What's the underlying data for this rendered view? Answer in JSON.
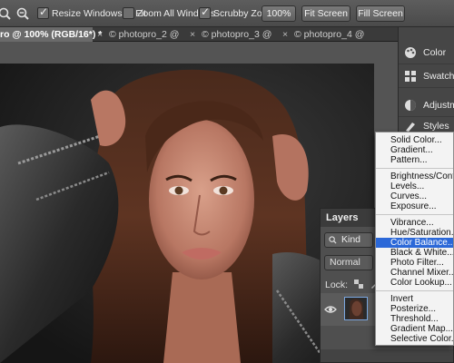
{
  "options_bar": {
    "resize_windows": {
      "label": "Resize Windows to Fit",
      "checked": true
    },
    "zoom_all": {
      "label": "Zoom All Windows",
      "checked": false
    },
    "scrubby_zoom": {
      "label": "Scrubby Zoom",
      "checked": true
    },
    "zoom_value": "100%",
    "fit_screen": "Fit Screen",
    "fill_screen": "Fill Screen"
  },
  "tabs": [
    {
      "label": "ro @ 100% (RGB/16*) *",
      "active": true
    },
    {
      "label": "© photopro_2 @",
      "active": false
    },
    {
      "label": "© photopro_3 @",
      "active": false
    },
    {
      "label": "© photopro_4 @",
      "active": false
    }
  ],
  "tab_close_glyph": "×",
  "dock": [
    {
      "label": "Color",
      "icon": "color-palette-icon"
    },
    {
      "label": "Swatches",
      "icon": "swatches-grid-icon"
    },
    {
      "label": "Adjustme",
      "icon": "adjustments-circle-icon"
    },
    {
      "label": "Styles",
      "icon": "styles-icon"
    }
  ],
  "layers_panel": {
    "title": "Layers",
    "filter_kind": "Kind",
    "blend_mode": "Normal",
    "lock_label": "Lock:"
  },
  "adjustment_menu": {
    "groups": [
      [
        "Solid Color...",
        "Gradient...",
        "Pattern..."
      ],
      [
        "Brightness/Contrast...",
        "Levels...",
        "Curves...",
        "Exposure..."
      ],
      [
        "Vibrance...",
        "Hue/Saturation...",
        "Color Balance...",
        "Black & White...",
        "Photo Filter...",
        "Channel Mixer...",
        "Color Lookup..."
      ],
      [
        "Invert",
        "Posterize...",
        "Threshold...",
        "Gradient Map...",
        "Selective Color..."
      ]
    ],
    "selected": "Color Balance..."
  },
  "colors": {
    "menu_highlight": "#2b68d8",
    "panel_bg": "#4f4f4f",
    "toolbar_bg": "#555555"
  }
}
